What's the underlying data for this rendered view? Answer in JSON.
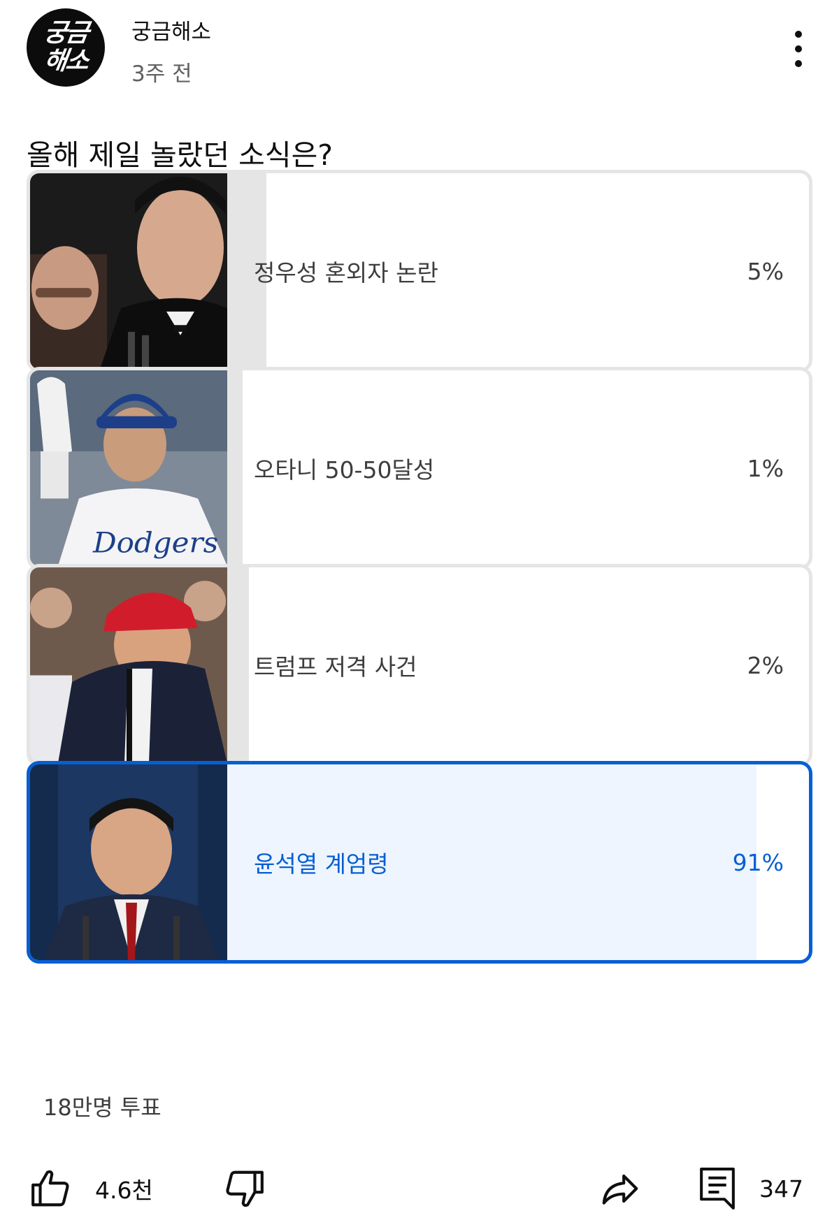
{
  "channel": {
    "avatar_lines": [
      "궁금",
      "해소"
    ],
    "name": "궁금해소",
    "time": "3주 전"
  },
  "question": "올해 제일 놀랐던 소식은?",
  "options": [
    {
      "label": "정우성 혼외자 논란",
      "percent_text": "5%",
      "percent": 5,
      "selected": false
    },
    {
      "label": "오타니 50-50달성",
      "percent_text": "1%",
      "percent": 1,
      "selected": false
    },
    {
      "label": "트럼프 저격 사건",
      "percent_text": "2%",
      "percent": 2,
      "selected": false
    },
    {
      "label": "윤석열 계엄령",
      "percent_text": "91%",
      "percent": 91,
      "selected": true
    }
  ],
  "votes": "18만명 투표",
  "actions": {
    "like_count": "4.6천",
    "comment_count": "347"
  },
  "colors": {
    "accent": "#065fd4",
    "selected_fill": "#eef5fe",
    "bar_fill": "#e5e5e5"
  }
}
